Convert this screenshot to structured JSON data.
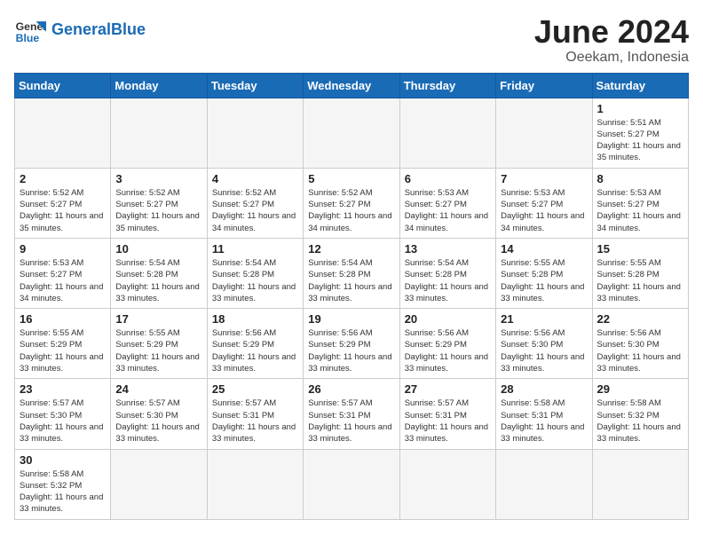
{
  "header": {
    "logo_general": "General",
    "logo_blue": "Blue",
    "title": "June 2024",
    "location": "Oeekam, Indonesia"
  },
  "weekdays": [
    "Sunday",
    "Monday",
    "Tuesday",
    "Wednesday",
    "Thursday",
    "Friday",
    "Saturday"
  ],
  "days": [
    {
      "date": 1,
      "sunrise": "5:51 AM",
      "sunset": "5:27 PM",
      "daylight": "11 hours and 35 minutes."
    },
    {
      "date": 2,
      "sunrise": "5:52 AM",
      "sunset": "5:27 PM",
      "daylight": "11 hours and 35 minutes."
    },
    {
      "date": 3,
      "sunrise": "5:52 AM",
      "sunset": "5:27 PM",
      "daylight": "11 hours and 35 minutes."
    },
    {
      "date": 4,
      "sunrise": "5:52 AM",
      "sunset": "5:27 PM",
      "daylight": "11 hours and 34 minutes."
    },
    {
      "date": 5,
      "sunrise": "5:52 AM",
      "sunset": "5:27 PM",
      "daylight": "11 hours and 34 minutes."
    },
    {
      "date": 6,
      "sunrise": "5:53 AM",
      "sunset": "5:27 PM",
      "daylight": "11 hours and 34 minutes."
    },
    {
      "date": 7,
      "sunrise": "5:53 AM",
      "sunset": "5:27 PM",
      "daylight": "11 hours and 34 minutes."
    },
    {
      "date": 8,
      "sunrise": "5:53 AM",
      "sunset": "5:27 PM",
      "daylight": "11 hours and 34 minutes."
    },
    {
      "date": 9,
      "sunrise": "5:53 AM",
      "sunset": "5:27 PM",
      "daylight": "11 hours and 34 minutes."
    },
    {
      "date": 10,
      "sunrise": "5:54 AM",
      "sunset": "5:28 PM",
      "daylight": "11 hours and 33 minutes."
    },
    {
      "date": 11,
      "sunrise": "5:54 AM",
      "sunset": "5:28 PM",
      "daylight": "11 hours and 33 minutes."
    },
    {
      "date": 12,
      "sunrise": "5:54 AM",
      "sunset": "5:28 PM",
      "daylight": "11 hours and 33 minutes."
    },
    {
      "date": 13,
      "sunrise": "5:54 AM",
      "sunset": "5:28 PM",
      "daylight": "11 hours and 33 minutes."
    },
    {
      "date": 14,
      "sunrise": "5:55 AM",
      "sunset": "5:28 PM",
      "daylight": "11 hours and 33 minutes."
    },
    {
      "date": 15,
      "sunrise": "5:55 AM",
      "sunset": "5:28 PM",
      "daylight": "11 hours and 33 minutes."
    },
    {
      "date": 16,
      "sunrise": "5:55 AM",
      "sunset": "5:29 PM",
      "daylight": "11 hours and 33 minutes."
    },
    {
      "date": 17,
      "sunrise": "5:55 AM",
      "sunset": "5:29 PM",
      "daylight": "11 hours and 33 minutes."
    },
    {
      "date": 18,
      "sunrise": "5:56 AM",
      "sunset": "5:29 PM",
      "daylight": "11 hours and 33 minutes."
    },
    {
      "date": 19,
      "sunrise": "5:56 AM",
      "sunset": "5:29 PM",
      "daylight": "11 hours and 33 minutes."
    },
    {
      "date": 20,
      "sunrise": "5:56 AM",
      "sunset": "5:29 PM",
      "daylight": "11 hours and 33 minutes."
    },
    {
      "date": 21,
      "sunrise": "5:56 AM",
      "sunset": "5:30 PM",
      "daylight": "11 hours and 33 minutes."
    },
    {
      "date": 22,
      "sunrise": "5:56 AM",
      "sunset": "5:30 PM",
      "daylight": "11 hours and 33 minutes."
    },
    {
      "date": 23,
      "sunrise": "5:57 AM",
      "sunset": "5:30 PM",
      "daylight": "11 hours and 33 minutes."
    },
    {
      "date": 24,
      "sunrise": "5:57 AM",
      "sunset": "5:30 PM",
      "daylight": "11 hours and 33 minutes."
    },
    {
      "date": 25,
      "sunrise": "5:57 AM",
      "sunset": "5:31 PM",
      "daylight": "11 hours and 33 minutes."
    },
    {
      "date": 26,
      "sunrise": "5:57 AM",
      "sunset": "5:31 PM",
      "daylight": "11 hours and 33 minutes."
    },
    {
      "date": 27,
      "sunrise": "5:57 AM",
      "sunset": "5:31 PM",
      "daylight": "11 hours and 33 minutes."
    },
    {
      "date": 28,
      "sunrise": "5:58 AM",
      "sunset": "5:31 PM",
      "daylight": "11 hours and 33 minutes."
    },
    {
      "date": 29,
      "sunrise": "5:58 AM",
      "sunset": "5:32 PM",
      "daylight": "11 hours and 33 minutes."
    },
    {
      "date": 30,
      "sunrise": "5:58 AM",
      "sunset": "5:32 PM",
      "daylight": "11 hours and 33 minutes."
    }
  ],
  "labels": {
    "sunrise": "Sunrise:",
    "sunset": "Sunset:",
    "daylight": "Daylight:"
  }
}
